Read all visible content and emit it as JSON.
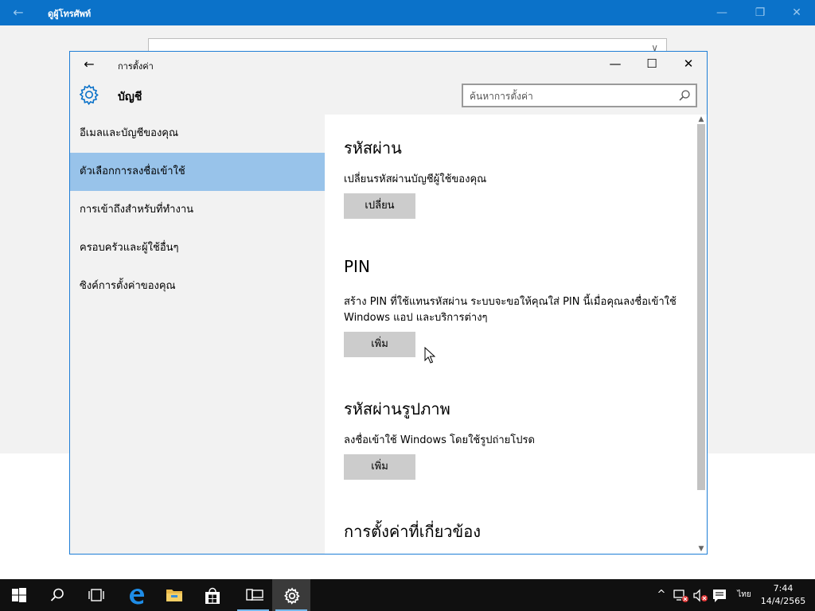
{
  "background_app": {
    "title": "ดูผู้โทรศัพท์",
    "back": "←",
    "minimize": "—",
    "restore": "❐",
    "close": "✕",
    "field_chevron": "∨"
  },
  "window": {
    "title": "การตั้งค่า",
    "back": "←",
    "minimize": "—",
    "maximize": "☐",
    "close": "✕"
  },
  "header": {
    "title": "บัญชี",
    "icon": "gear-icon"
  },
  "search": {
    "placeholder": "ค้นหาการตั้งค่า",
    "icon": "search-icon"
  },
  "sidebar": {
    "items": [
      {
        "label": "อีเมลและบัญชีของคุณ",
        "selected": false
      },
      {
        "label": "ตัวเลือกการลงชื่อเข้าใช้",
        "selected": true
      },
      {
        "label": "การเข้าถึงสำหรับที่ทำงาน",
        "selected": false
      },
      {
        "label": "ครอบครัวและผู้ใช้อื่นๆ",
        "selected": false
      },
      {
        "label": "ซิงค์การตั้งค่าของคุณ",
        "selected": false
      }
    ]
  },
  "sections": {
    "password": {
      "heading": "รหัสผ่าน",
      "description": "เปลี่ยนรหัสผ่านบัญชีผู้ใช้ของคุณ",
      "button": "เปลี่ยน"
    },
    "pin": {
      "heading": "PIN",
      "description": "สร้าง PIN ที่ใช้แทนรหัสผ่าน ระบบจะขอให้คุณใส่ PIN นี้เมื่อคุณลงชื่อเข้าใช้ Windows แอป และบริการต่างๆ",
      "button": "เพิ่ม"
    },
    "picture_password": {
      "heading": "รหัสผ่านรูปภาพ",
      "description": "ลงชื่อเข้าใช้ Windows โดยใช้รูปถ่ายโปรด",
      "button": "เพิ่ม"
    },
    "related": {
      "heading": "การตั้งค่าที่เกี่ยวข้อง"
    }
  },
  "scrollbar": {
    "up": "▲",
    "down": "▼"
  },
  "taskbar": {
    "apps": [
      "start",
      "search",
      "task-view",
      "edge",
      "file-explorer",
      "store",
      "phone-companion",
      "settings"
    ],
    "tray": {
      "chevron": "^",
      "language": "ไทย"
    },
    "clock": {
      "time": "7:44",
      "date": "14/4/2565"
    }
  },
  "colors": {
    "accent": "#0b72c9",
    "selected_nav": "#98c3ea",
    "taskbar": "#101010",
    "button": "#cccccc"
  }
}
